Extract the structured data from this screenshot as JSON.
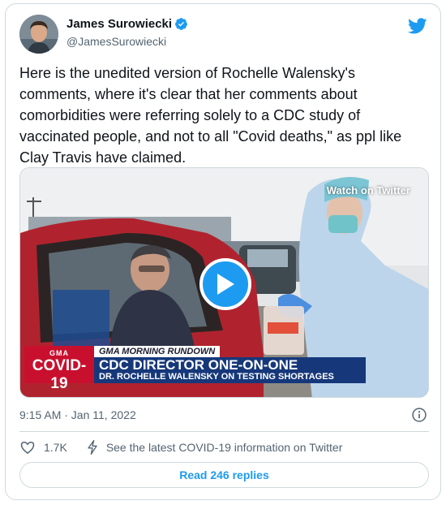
{
  "author": {
    "name": "James Surowiecki",
    "handle": "@JamesSurowiecki",
    "verified": true,
    "avatar_icon": "person-avatar"
  },
  "brand_icon": "twitter-bird-icon",
  "tweet": {
    "text": "Here is the unedited version of Rochelle Walensky's comments, where it's clear that her comments about comorbidities were referring solely to a CDC study of vaccinated people, and not to all \"Covid deaths,\" as ppl like Clay Travis have claimed."
  },
  "media": {
    "watch_label": "Watch on Twitter",
    "play_icon": "play-icon",
    "lower_third": {
      "network": "GMA",
      "badge": "COVID-19",
      "segment": "GMA MORNING RUNDOWN",
      "headline": "CDC DIRECTOR ONE-ON-ONE",
      "subhead": "DR. ROCHELLE WALENSKY ON TESTING SHORTAGES"
    }
  },
  "meta": {
    "timestamp": "9:15 AM · Jan 11, 2022",
    "info_icon": "info-icon"
  },
  "actions": {
    "likes": "1.7K",
    "covid_info": "See the latest COVID-19 information on Twitter"
  },
  "replies_button": "Read 246 replies",
  "colors": {
    "accent": "#1d9bf0",
    "text": "#0f1419",
    "muted": "#536471",
    "border": "#cfd9de",
    "covid_red": "#c8102e",
    "headline_blue": "#16387a"
  }
}
